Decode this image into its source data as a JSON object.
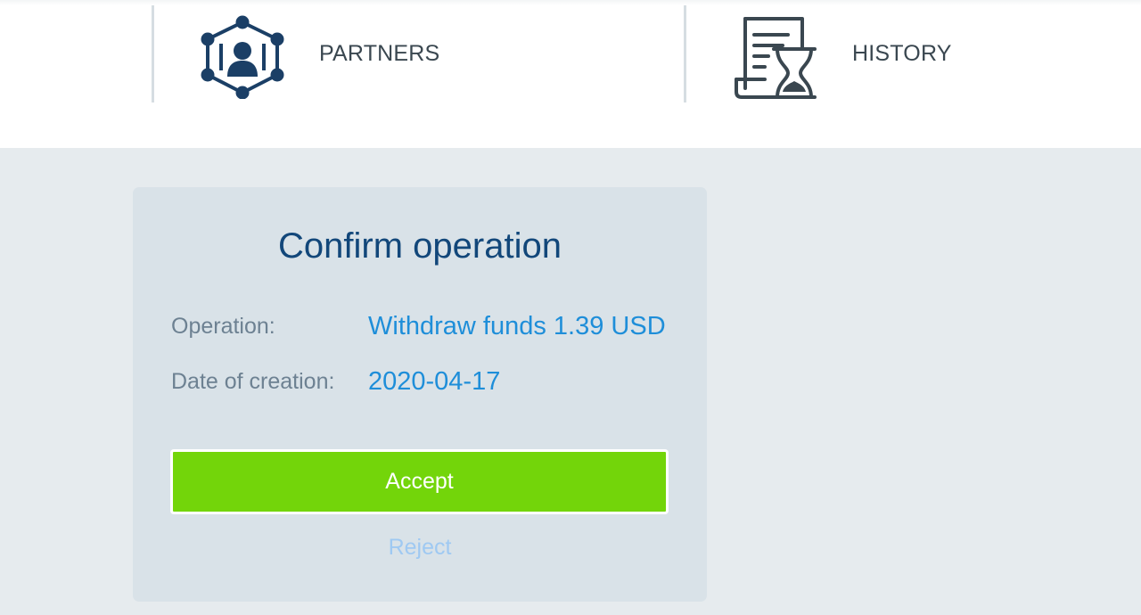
{
  "nav": {
    "items": [
      {
        "label": "PARTNERS",
        "icon": "partners-network-icon"
      },
      {
        "label": "HISTORY",
        "icon": "history-document-hourglass-icon"
      }
    ]
  },
  "dialog": {
    "title": "Confirm operation",
    "rows": [
      {
        "label": "Operation:",
        "value": "Withdraw funds 1.39 USD"
      },
      {
        "label": "Date of creation:",
        "value": "2020-04-17"
      }
    ],
    "accept_label": "Accept",
    "reject_label": "Reject"
  },
  "colors": {
    "title": "#12477a",
    "value": "#1e8ed9",
    "accept": "#73d50a",
    "reject": "#9fc9f2",
    "icon": "#1b3f66"
  }
}
